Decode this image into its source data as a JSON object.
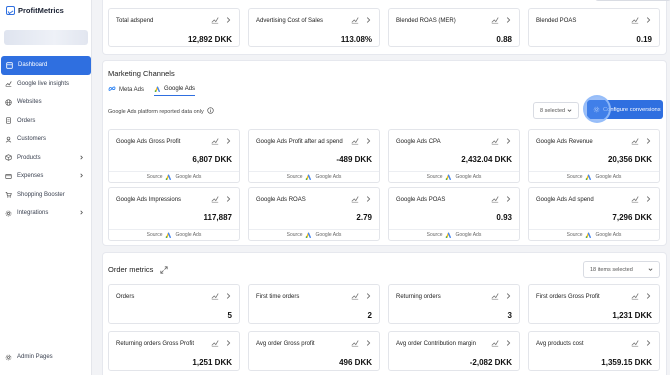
{
  "app": {
    "name": "ProfitMetrics"
  },
  "colors": {
    "accent": "#2f6fe0",
    "sidebar_bg": "#ffffff",
    "page_bg": "#f2f3f6"
  },
  "sidebar": {
    "items": [
      {
        "label": "Dashboard",
        "icon": "dashboard-icon",
        "active": true
      },
      {
        "label": "Google live insights",
        "icon": "chart-icon"
      },
      {
        "label": "Websites",
        "icon": "globe-icon"
      },
      {
        "label": "Orders",
        "icon": "orders-icon"
      },
      {
        "label": "Customers",
        "icon": "customers-icon"
      },
      {
        "label": "Products",
        "icon": "box-icon",
        "chevron": true
      },
      {
        "label": "Expenses",
        "icon": "expenses-icon",
        "chevron": true
      },
      {
        "label": "Shopping Booster",
        "icon": "cart-icon"
      },
      {
        "label": "Integrations",
        "icon": "gear-icon",
        "chevron": true
      }
    ],
    "admin_label": "Admin Pages"
  },
  "overview": {
    "cards": [
      {
        "title": "Total adspend",
        "value": "12,892 DKK"
      },
      {
        "title": "Advertising Cost of Sales",
        "value": "113.08%"
      },
      {
        "title": "Blended ROAS (MER)",
        "value": "0.88"
      },
      {
        "title": "Blended POAS",
        "value": "0.19"
      }
    ]
  },
  "marketing": {
    "title": "Marketing Channels",
    "tabs": [
      {
        "label": "Meta Ads"
      },
      {
        "label": "Google Ads"
      }
    ],
    "note": "Google Ads platform reported data only",
    "selected": "8 selected",
    "configure_label": "Configure conversions",
    "source_label": "Source",
    "source_name": "Google Ads",
    "cards": [
      {
        "title": "Google Ads Gross Profit",
        "value": "6,807 DKK"
      },
      {
        "title": "Google Ads Profit after ad spend",
        "value": "-489 DKK"
      },
      {
        "title": "Google Ads CPA",
        "value": "2,432.04 DKK"
      },
      {
        "title": "Google Ads Revenue",
        "value": "20,356 DKK"
      },
      {
        "title": "Google Ads Impressions",
        "value": "117,887"
      },
      {
        "title": "Google Ads ROAS",
        "value": "2.79"
      },
      {
        "title": "Google Ads POAS",
        "value": "0.93"
      },
      {
        "title": "Google Ads Ad spend",
        "value": "7,296 DKK"
      }
    ]
  },
  "orders": {
    "title": "Order metrics",
    "selected": "18 items selected",
    "cards": [
      {
        "title": "Orders",
        "value": "5"
      },
      {
        "title": "First time orders",
        "value": "2"
      },
      {
        "title": "Returning orders",
        "value": "3"
      },
      {
        "title": "First orders Gross Profit",
        "value": "1,231 DKK"
      },
      {
        "title": "Returning orders Gross Profit",
        "value": "1,251 DKK"
      },
      {
        "title": "Avg order Gross profit",
        "value": "496 DKK"
      },
      {
        "title": "Avg order Contribution margin",
        "value": "-2,082 DKK"
      },
      {
        "title": "Avg products cost",
        "value": "1,359.15 DKK"
      }
    ]
  }
}
